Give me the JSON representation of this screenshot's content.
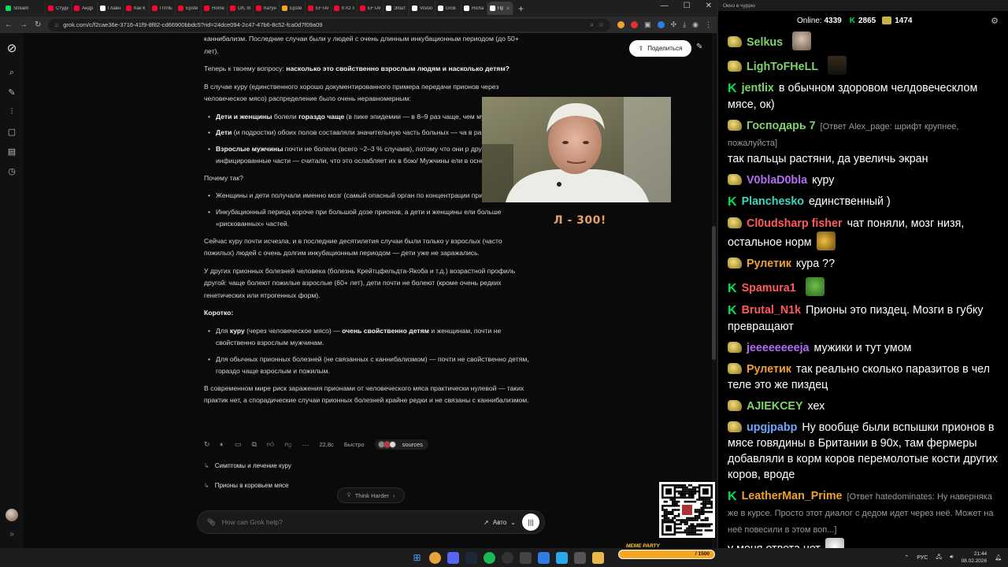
{
  "browser": {
    "tabs": [
      {
        "label": "Stream",
        "color": "#00e05a",
        "active": false
      },
      {
        "label": "Студи",
        "color": "#ff0033",
        "active": false
      },
      {
        "label": "Андр",
        "color": "#ff0033",
        "active": false
      },
      {
        "label": "Главн",
        "color": "#ffffff",
        "active": false
      },
      {
        "label": "Как К",
        "color": "#ff0033",
        "active": false
      },
      {
        "label": "ПУЛЬ",
        "color": "#ff0033",
        "active": false
      },
      {
        "label": "Epste",
        "color": "#ff0033",
        "active": false
      },
      {
        "label": "Home:",
        "color": "#ff0033",
        "active": false
      },
      {
        "label": "Oh, m",
        "color": "#ff0033",
        "active": false
      },
      {
        "label": "Катун",
        "color": "#ff0033",
        "active": false
      },
      {
        "label": "Epste",
        "color": "#f5a623",
        "active": false
      },
      {
        "label": "EFTAC",
        "color": "#ff0033",
        "active": false
      },
      {
        "label": "КТО У",
        "color": "#ff0033",
        "active": false
      },
      {
        "label": "EFTAC",
        "color": "#ff0033",
        "active": false
      },
      {
        "label": "Эпшт",
        "color": "#ffffff",
        "active": false
      },
      {
        "label": "Vision",
        "color": "#ffffff",
        "active": false
      },
      {
        "label": "Grok",
        "color": "#ffffff",
        "active": false
      },
      {
        "label": "Richa",
        "color": "#ffffff",
        "active": false
      },
      {
        "label": "Пр",
        "color": "#ffffff",
        "active": true
      }
    ],
    "url": "grok.com/c/f2cae36e-3716-41f9-8f82-cd66900bbdc5?rid=24dce094-2c47-47b6-8c52-fca0d7f09a09"
  },
  "grok": {
    "share_label": "Поделиться",
    "intro": "каннибализм. Последние случаи были у людей с очень длинным инкубационным периодом (до 50+ лет).",
    "question_prefix": "Теперь к твоему вопросу: ",
    "question_bold": "насколько это свойственно взрослым людям и насколько детям?",
    "kuru_intro": "В случае куру (единственного хорошо документированного примера передачи прионов через человеческое мясо) распределение было очень неравномерным:",
    "b1_bold": "Дети и женщины",
    "b1_mid": " болели ",
    "b1_bold2": "гораздо чаще",
    "b1_rest": " (в пике эпидемии — в 8–9 раз чаще, чем мужчины).",
    "b2_bold": "Дети",
    "b2_rest": " (и подростки) обоих полов составляли значительную часть больных — ча в раннем возрасте.",
    "b3_bold": "Взрослые мужчины",
    "b3_rest": " почти не болели (всего ~2–3 % случаев), потому что они р другие высоко-инфицированные части — считали, что это ослабляет их в бою/ Мужчины ели в основном мышцы.",
    "why": "Почему так?",
    "w1": "Женщины и дети получали именно мозг (самый опасный орган по концентрации прионов).",
    "w2": "Инкубационный период короче при большой дозе прионов, а дети и женщины ели больше «рискованных» частей.",
    "p_now": "Сейчас куру почти исчезла, и в последние десятилетия случаи были только у взрослых (часто пожилых) людей с очень долгим инкубационным периодом — дети уже не заражались.",
    "p_other": "У других прионных болезней человека (болезнь Крейтцфельдта-Якоба и т.д.) возрастной профиль другой: чаще болеют пожилые взрослые (60+ лет), дети почти не болеют (кроме очень редких генетических или ятрогенных форм).",
    "short": "Коротко:",
    "s1_a": "Для ",
    "s1_bold": "куру",
    "s1_b": " (через человеческое мясо) — ",
    "s1_bold2": "очень свойственно детям",
    "s1_c": " и женщинам, почти не свойственно взрослым мужчинам.",
    "s2": "Для обычных прионных болезней (не связанных с каннибализмом) — почти не свойственно детям, гораздо чаще взрослым и пожилым.",
    "closing": "В современном мире риск заражения прионами от человеческого мяса практически нулевой — таких практик нет, а спорадические случаи прионных болезней крайне редки и не связаны с каннибализмом.",
    "time": "22,8с",
    "speed": "Быстро",
    "sources": "sources",
    "related1": "Симптомы и лечение куру",
    "related2": "Прионы в коровьем мясе",
    "think_harder": "Think Harder",
    "placeholder": "How can Grok help?",
    "mode": "Авто"
  },
  "overlay": {
    "caption": "Л - 300!"
  },
  "stream_chat": {
    "window_title": "Окно в чуррю",
    "online_label": "Online:",
    "online": "4339",
    "kick_count": "2865",
    "sub_count": "1474",
    "messages": [
      {
        "user": "Selkus",
        "color": "#7fd36b",
        "badge": "gold",
        "text": "",
        "emote": "face"
      },
      {
        "user": "LighToFHeLL",
        "color": "#7fd36b",
        "badge": "gold",
        "text": "",
        "emote": "dark"
      },
      {
        "user": "jentlix",
        "color": "#7fd36b",
        "badge": "kick",
        "text": "в обычном здоровом челдовеческлом мясе, ок)"
      },
      {
        "user": "Господарь 7",
        "color": "#7fd36b",
        "badge": "gold",
        "reply": "[Ответ Alex_page: шрифт крупнее, пожалуйста]",
        "text": "так пальцы растяни, да увеличь экран"
      },
      {
        "user": "V0blaD0bla",
        "color": "#b46cf2",
        "badge": "gold",
        "text": "куру"
      },
      {
        "user": "Planchesko",
        "color": "#3ad6c2",
        "badge": "kick",
        "text": "единственный )"
      },
      {
        "user": "Cl0udsharp fisher",
        "color": "#ff5a5a",
        "badge": "gold",
        "text": "чат поняли, мозг низя, остальное норм",
        "emote": "fish"
      },
      {
        "user": "Рулетик",
        "color": "#f0a030",
        "badge": "gold",
        "text": "кура ??"
      },
      {
        "user": "Spamura1",
        "color": "#ff5a5a",
        "badge": "kick",
        "text": "",
        "emote": "pepe"
      },
      {
        "user": "Brutal_N1k",
        "color": "#ff5a5a",
        "badge": "kick",
        "text": "Прионы это пиздец. Мозги в губку превращают"
      },
      {
        "user": "jeeeeeeeeja",
        "color": "#b46cf2",
        "badge": "gold",
        "text": "мужики и тут умом"
      },
      {
        "user": "Рулетик",
        "color": "#f0a030",
        "badge": "gold",
        "text": "так реально сколько паразитов в чел теле это же пиздец"
      },
      {
        "user": "AJIEKCEY",
        "color": "#7fd36b",
        "badge": "gold",
        "text": "хех"
      },
      {
        "user": "upgjpabp",
        "color": "#6fa6ff",
        "badge": "gold",
        "text": "Ну вообще были вспышки прионов в мясе говядины в Британии в 90х, там фермеры добавляли в корм коров перемолотые кости других коров, вроде"
      },
      {
        "user": "LeatherMan_Prime",
        "color": "#f0a030",
        "badge": "kick",
        "reply": "[Ответ hatedominates: Ну наверняка же в курсе. Просто этот диалог с дедом идет через неё. Может на неё повесили в этом воп...]",
        "text": "у меня ответа нет",
        "emote": "joker"
      }
    ]
  },
  "taskbar": {
    "lang": "РУС",
    "time": "21:44",
    "date": "08.02.2026",
    "banner": "MEME PARTY",
    "banner_counter": "/ 1500"
  }
}
